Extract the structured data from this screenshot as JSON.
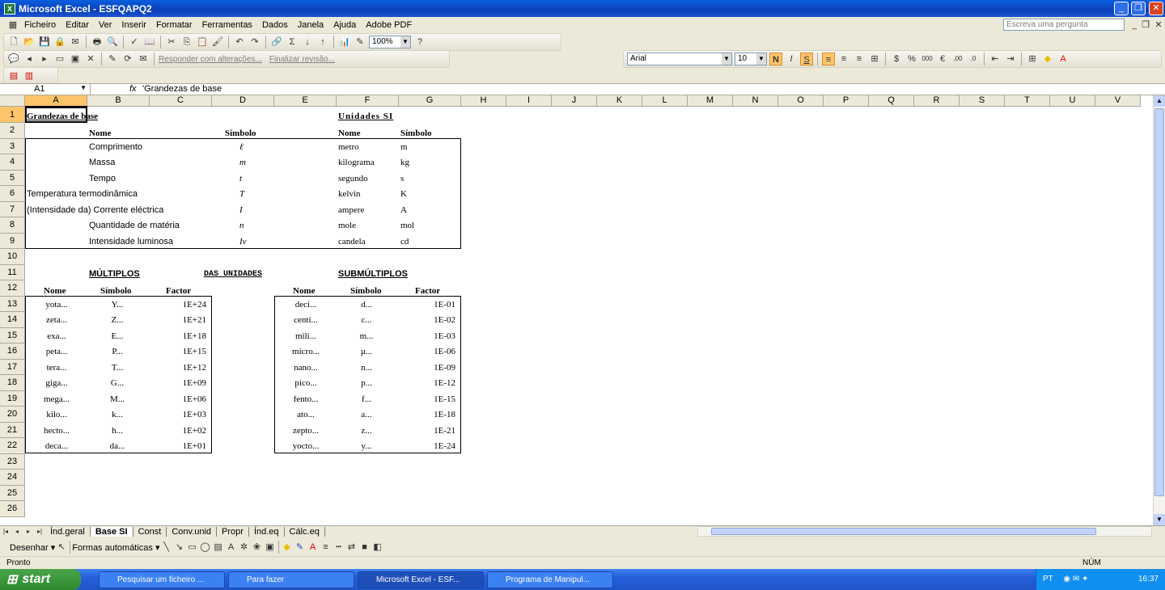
{
  "window": {
    "title": "Microsoft Excel - ESFQAPQ2"
  },
  "menu": {
    "items": [
      "Ficheiro",
      "Editar",
      "Ver",
      "Inserir",
      "Formatar",
      "Ferramentas",
      "Dados",
      "Janela",
      "Ajuda",
      "Adobe PDF"
    ],
    "ask_placeholder": "Escreva uma pergunta"
  },
  "toolbar": {
    "zoom": "100%",
    "reply_changes": "Responder com alterações...",
    "end_review": "Finalizar revisão...",
    "font": "Arial",
    "font_size": "10",
    "bold": "N",
    "italic": "I",
    "underline": "S"
  },
  "formula_bar": {
    "name_box": "A1",
    "fx": "fx",
    "value": "'Grandezas de base"
  },
  "columns": [
    "A",
    "B",
    "C",
    "D",
    "E",
    "F",
    "G",
    "H",
    "I",
    "J",
    "K",
    "L",
    "M",
    "N",
    "O",
    "P",
    "Q",
    "R",
    "S",
    "T",
    "U",
    "V"
  ],
  "rows": [
    "1",
    "2",
    "3",
    "4",
    "5",
    "6",
    "7",
    "8",
    "9",
    "10",
    "11",
    "12",
    "13",
    "14",
    "15",
    "16",
    "17",
    "18",
    "19",
    "20",
    "21",
    "22",
    "23",
    "24",
    "25",
    "26"
  ],
  "sheet": {
    "title_base": "Grandezas de base",
    "title_units": "Unidades SI",
    "hdr_nome": "Nome",
    "hdr_simbolo": "Símbolo",
    "base": [
      {
        "nome": "Comprimento",
        "simbolo": "ℓ",
        "unidade": "metro",
        "usimb": "m"
      },
      {
        "nome": "Massa",
        "simbolo": "m",
        "unidade": "kilograma",
        "usimb": "kg"
      },
      {
        "nome": "Tempo",
        "simbolo": "t",
        "unidade": "segundo",
        "usimb": "s"
      },
      {
        "nome": "Temperatura termodinâmica",
        "simbolo": "T",
        "unidade": "kelvin",
        "usimb": "K"
      },
      {
        "nome": "(Intensidade da) Corrente eléctrica",
        "simbolo": "I",
        "unidade": "ampere",
        "usimb": "A"
      },
      {
        "nome": "Quantidade de matéria",
        "simbolo": "n",
        "unidade": "mole",
        "usimb": "mol"
      },
      {
        "nome": "Intensidade luminosa",
        "simbolo": "Iv",
        "unidade": "candela",
        "usimb": "cd"
      }
    ],
    "multiplos_title": "MÚLTIPLOS",
    "das_unidades": "DAS UNIDADES",
    "submultiplos_title": "SUBMÚLTIPLOS",
    "hdr_factor": "Factor",
    "multiplos": [
      {
        "nome": "yota...",
        "simbolo": "Y...",
        "factor": "1E+24"
      },
      {
        "nome": "zeta...",
        "simbolo": "Z...",
        "factor": "1E+21"
      },
      {
        "nome": "exa...",
        "simbolo": "E...",
        "factor": "1E+18"
      },
      {
        "nome": "peta...",
        "simbolo": "P...",
        "factor": "1E+15"
      },
      {
        "nome": "tera...",
        "simbolo": "T...",
        "factor": "1E+12"
      },
      {
        "nome": "giga...",
        "simbolo": "G...",
        "factor": "1E+09"
      },
      {
        "nome": "mega...",
        "simbolo": "M...",
        "factor": "1E+06"
      },
      {
        "nome": "kilo...",
        "simbolo": "k...",
        "factor": "1E+03"
      },
      {
        "nome": "hecto...",
        "simbolo": "h...",
        "factor": "1E+02"
      },
      {
        "nome": "deca...",
        "simbolo": "da...",
        "factor": "1E+01"
      }
    ],
    "submultiplos": [
      {
        "nome": "deci...",
        "simbolo": "d...",
        "factor": "1E-01"
      },
      {
        "nome": "centi...",
        "simbolo": "c...",
        "factor": "1E-02"
      },
      {
        "nome": "mili...",
        "simbolo": "m...",
        "factor": "1E-03"
      },
      {
        "nome": "micro...",
        "simbolo": "µ...",
        "factor": "1E-06"
      },
      {
        "nome": "nano...",
        "simbolo": "n...",
        "factor": "1E-09"
      },
      {
        "nome": "pico...",
        "simbolo": "p...",
        "factor": "1E-12"
      },
      {
        "nome": "fento...",
        "simbolo": "f...",
        "factor": "1E-15"
      },
      {
        "nome": "ato...",
        "simbolo": "a...",
        "factor": "1E-18"
      },
      {
        "nome": "zepto...",
        "simbolo": "z...",
        "factor": "1E-21"
      },
      {
        "nome": "yocto...",
        "simbolo": "y...",
        "factor": "1E-24"
      }
    ]
  },
  "tabs": [
    "Índ.geral",
    "Base SI",
    "Const",
    "Conv.unid",
    "Propr",
    "Índ.eq",
    "Cálc.eq"
  ],
  "drawing": {
    "draw": "Desenhar",
    "autoshapes": "Formas automáticas"
  },
  "status": {
    "left": "Pronto",
    "num": "NÚM"
  },
  "taskbar": {
    "start": "start",
    "tasks": [
      "Pesquisar um ficheiro ...",
      "Para fazer",
      "Microsoft Excel - ESF...",
      "Programa de Manipul..."
    ],
    "lang": "PT",
    "clock": "16:37"
  }
}
